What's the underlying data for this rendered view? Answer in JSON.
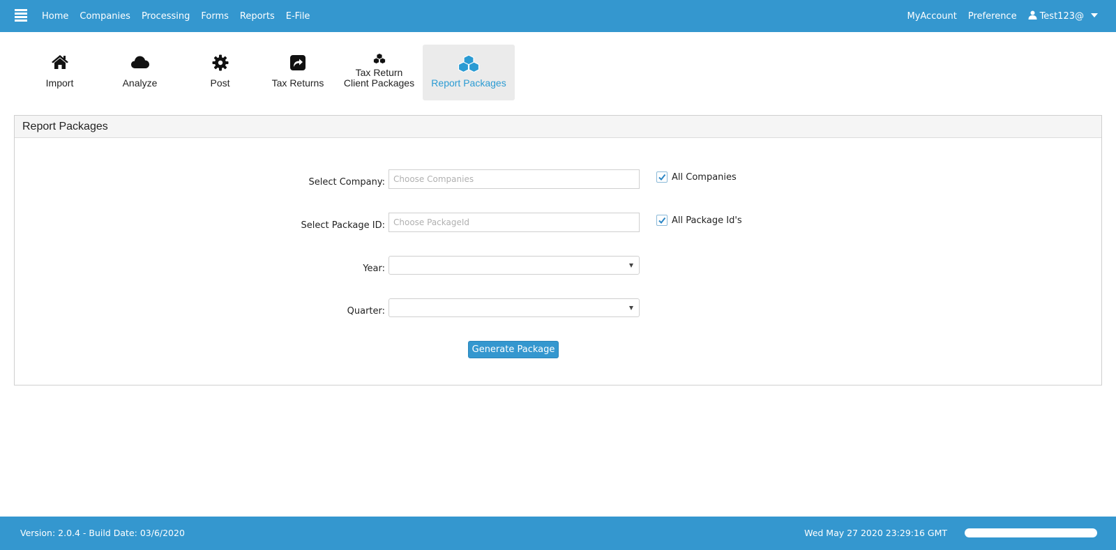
{
  "navbar": {
    "menu_items": [
      "Home",
      "Companies",
      "Processing",
      "Forms",
      "Reports",
      "E-File"
    ],
    "my_account": "MyAccount",
    "preference": "Preference",
    "user": "Test123@"
  },
  "toolbar": {
    "items": [
      {
        "label": "Import",
        "icon": "home-icon"
      },
      {
        "label": "Analyze",
        "icon": "cloud-icon"
      },
      {
        "label": "Post",
        "icon": "gear-icon"
      },
      {
        "label": "Tax Returns",
        "icon": "share-square-icon"
      },
      {
        "label_line1": "Tax Return",
        "label_line2": "Client Packages",
        "icon": "cubes-icon"
      },
      {
        "label": "Report Packages",
        "icon": "cubes-icon",
        "active": true
      }
    ]
  },
  "panel": {
    "title": "Report Packages",
    "company": {
      "label": "Select Company:",
      "placeholder": "Choose Companies",
      "all_label": "All Companies",
      "all_checked": true
    },
    "package": {
      "label": "Select Package ID:",
      "placeholder": "Choose PackageId",
      "all_label": "All Package Id's",
      "all_checked": true
    },
    "year": {
      "label": "Year:",
      "value": ""
    },
    "quarter": {
      "label": "Quarter:",
      "value": ""
    },
    "generate_button": "Generate Package"
  },
  "footer": {
    "version": "Version: 2.0.4 - Build Date: 03/6/2020",
    "datetime": "Wed May 27 2020 23:29:16 GMT"
  },
  "colors": {
    "brand": "#3497cf",
    "active_text": "#2b9bd3",
    "active_bg": "#ebebeb"
  }
}
